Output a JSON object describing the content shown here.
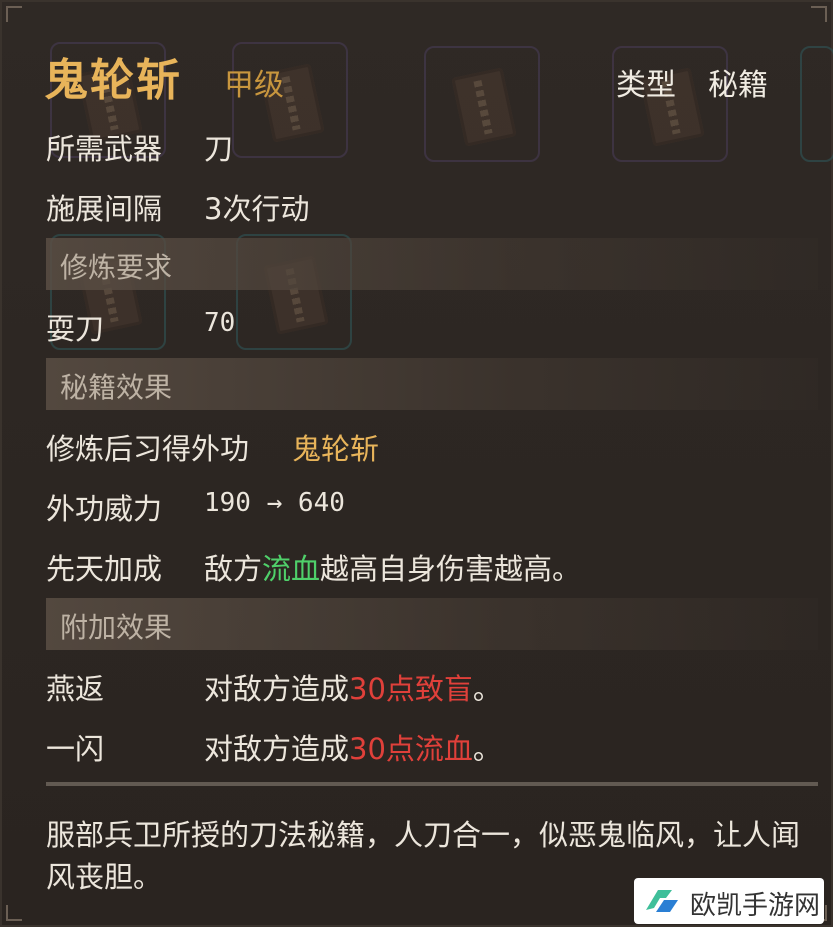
{
  "item": {
    "name": "鬼轮斩",
    "grade": "甲级",
    "type_label": "类型",
    "type_value": "秘籍"
  },
  "basic": [
    {
      "label": "所需武器",
      "value": "刀"
    },
    {
      "label": "施展间隔",
      "value": "3次行动"
    }
  ],
  "requirements": {
    "header": "修炼要求",
    "rows": [
      {
        "label": "耍刀",
        "value": "70"
      }
    ]
  },
  "effects": {
    "header": "秘籍效果",
    "learn_label": "修炼后习得外功",
    "learn_value": "鬼轮斩",
    "power_label": "外功威力",
    "power_value": "190 → 640",
    "innate_label": "先天加成",
    "innate_pre": "敌方",
    "innate_highlight": "流血",
    "innate_post": "越高自身伤害越高。"
  },
  "extra": {
    "header": "附加效果",
    "rows": [
      {
        "label": "燕返",
        "pre": "对敌方造成",
        "highlight": "30点致盲",
        "post": "。"
      },
      {
        "label": "一闪",
        "pre": "对敌方造成",
        "highlight": "30点流血",
        "post": "。"
      }
    ]
  },
  "description": "服部兵卫所授的刀法秘籍，人刀合一，似恶鬼临风，让人闻风丧胆。",
  "watermark": "欧凯手游网",
  "colors": {
    "title": "#e8b45a",
    "green": "#4fd06a",
    "red": "#e0403a"
  }
}
